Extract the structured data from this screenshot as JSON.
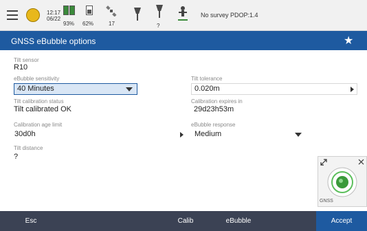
{
  "status": {
    "time": "12:17",
    "date": "06/22",
    "battery_left": "93%",
    "battery_right": "62%",
    "satellites": "17",
    "unknown_count": "?",
    "survey_status": "No survey PDOP:1.4"
  },
  "header": {
    "title": "GNSS eBubble options"
  },
  "form": {
    "tilt_sensor_label": "Tilt sensor",
    "tilt_sensor_value": "R10",
    "sensitivity_label": "eBubble sensitivity",
    "sensitivity_value": "40 Minutes",
    "tilt_tolerance_label": "Tilt tolerance",
    "tilt_tolerance_value": "0.020m",
    "calib_status_label": "Tilt calibration status",
    "calib_status_value": "Tilt calibrated OK",
    "calib_expires_label": "Calibration expires in",
    "calib_expires_value": "29d23h53m",
    "calib_age_label": "Calibration age limit",
    "calib_age_value": "30d0h",
    "response_label": "eBubble response",
    "response_value": "Medium",
    "tilt_distance_label": "Tilt distance",
    "tilt_distance_value": "?"
  },
  "widget": {
    "label": "GNSS"
  },
  "footer": {
    "esc": "Esc",
    "calib": "Calib",
    "ebubble": "eBubble",
    "accept": "Accept"
  },
  "colors": {
    "accent": "#1e5aa0",
    "footer_bg": "#3b4254",
    "status_bg": "#f1f1f1"
  },
  "icons": [
    "menu-icon",
    "gnss-status-icon",
    "battery-icon",
    "battery-icon",
    "satellite-icon",
    "radio-icon",
    "antenna-icon",
    "person-icon",
    "star-icon",
    "expand-icon",
    "close-icon",
    "ebubble-icon"
  ]
}
